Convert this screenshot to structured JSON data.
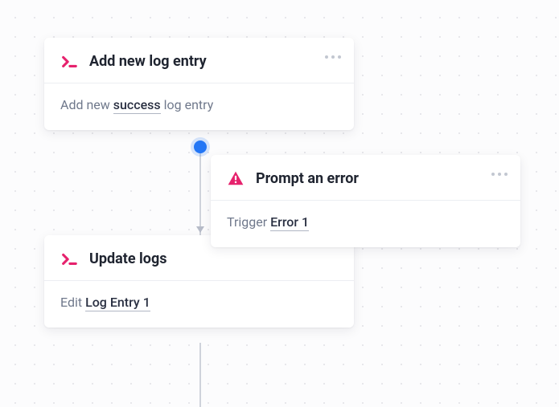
{
  "cards": {
    "add_log": {
      "title": "Add new log entry",
      "body_prefix": "Add new ",
      "body_var": "success",
      "body_suffix": " log entry"
    },
    "prompt_error": {
      "title": "Prompt an error",
      "body_prefix": "Trigger ",
      "body_var": "Error 1",
      "body_suffix": ""
    },
    "update_logs": {
      "title": "Update logs",
      "body_prefix": "Edit ",
      "body_var": "Log Entry 1",
      "body_suffix": ""
    }
  }
}
